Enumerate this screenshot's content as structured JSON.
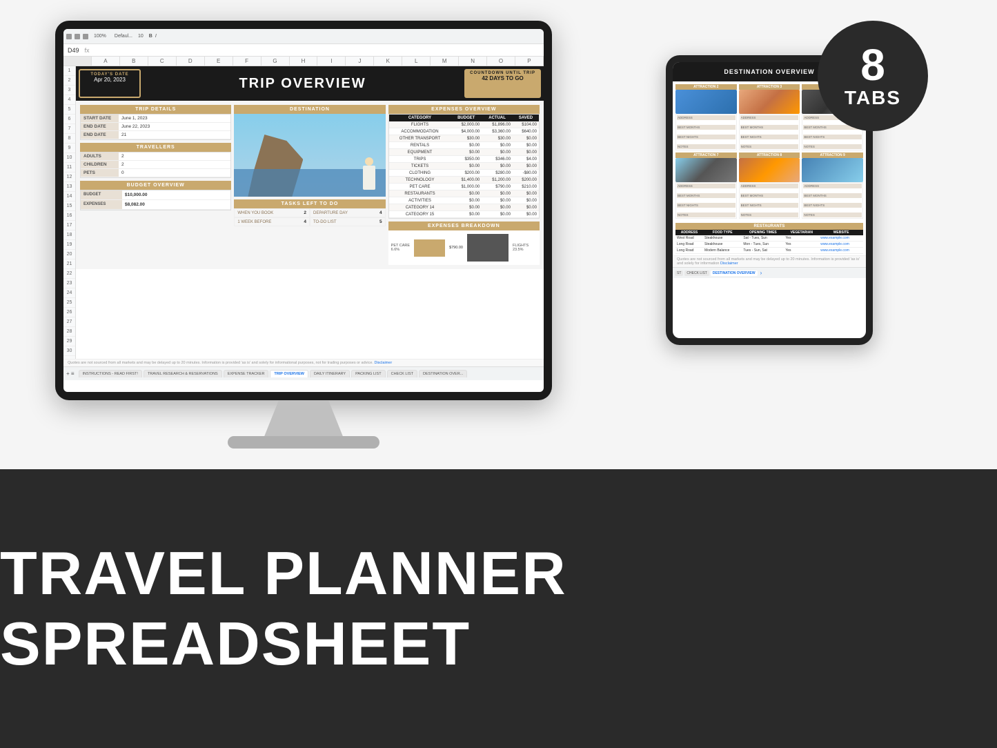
{
  "top_section": {
    "badge": {
      "number": "8",
      "word": "TABS"
    }
  },
  "spreadsheet": {
    "toolbar": {
      "zoom": "100%",
      "font": "Defaul...",
      "size": "10",
      "cell_ref": "D49"
    },
    "header": {
      "today_label": "TODAY'S DATE",
      "today_date": "Apr 20, 2023",
      "title": "TRIP OVERVIEW",
      "countdown_label": "COUNTDOWN UNTIL TRIP",
      "countdown_value": "42 DAYS TO GO"
    },
    "trip_details": {
      "header": "TRIP DETAILS",
      "rows": [
        {
          "label": "START DATE",
          "value": "June 1, 2023"
        },
        {
          "label": "END DATE",
          "value": "June 22, 2023"
        },
        {
          "label": "END DATE",
          "value": "21"
        }
      ]
    },
    "travellers": {
      "header": "TRAVELLERS",
      "rows": [
        {
          "label": "ADULTS",
          "value": "2"
        },
        {
          "label": "CHILDREN",
          "value": "2"
        },
        {
          "label": "PETS",
          "value": "0"
        }
      ]
    },
    "budget": {
      "header": "BUDGET OVERVIEW",
      "rows": [
        {
          "label": "BUDGET",
          "value": "$10,000.00"
        },
        {
          "label": "EXPENSES",
          "value": "$8,082.00"
        }
      ]
    },
    "destination": {
      "header": "DESTINATION"
    },
    "tasks": {
      "header": "TASKS LEFT TO DO",
      "cells": [
        {
          "label": "WHEN YOU BOOK",
          "value": "2"
        },
        {
          "label": "DEPARTURE DAY",
          "value": "4"
        },
        {
          "label": "1 WEEK BEFORE",
          "value": "4"
        },
        {
          "label": "TO-DO LIST",
          "value": "5"
        }
      ]
    },
    "expenses_overview": {
      "header": "EXPENSES OVERVIEW",
      "columns": [
        "CATEGORY",
        "BUDGET",
        "ACTUAL",
        "SAVED"
      ],
      "rows": [
        {
          "category": "FLIGHTS",
          "budget": "$2,000.00",
          "actual": "$1,896.00",
          "saved": "$104.00"
        },
        {
          "category": "ACCOMMODATION",
          "budget": "$4,000.00",
          "actual": "$3,360.00",
          "saved": "$640.00"
        },
        {
          "category": "OTHER TRANSPORT",
          "budget": "$30.00",
          "actual": "$30.00",
          "saved": "$0.00"
        },
        {
          "category": "RENTALS",
          "budget": "$0.00",
          "actual": "$0.00",
          "saved": "$0.00"
        },
        {
          "category": "EQUIPMENT",
          "budget": "$0.00",
          "actual": "$0.00",
          "saved": "$0.00"
        },
        {
          "category": "TRIPS",
          "budget": "$350.00",
          "actual": "$346.00",
          "saved": "$4.00"
        },
        {
          "category": "TICKETS",
          "budget": "$0.00",
          "actual": "$0.00",
          "saved": "$0.00"
        },
        {
          "category": "CLOTHING",
          "budget": "$200.00",
          "actual": "$280.00",
          "saved": "-$80.00"
        },
        {
          "category": "TECHNOLOGY",
          "budget": "$1,400.00",
          "actual": "$1,200.00",
          "saved": "$200.00"
        },
        {
          "category": "PET CARE",
          "budget": "$1,000.00",
          "actual": "$790.00",
          "saved": "$210.00"
        },
        {
          "category": "RESTAURANTS",
          "budget": "$0.00",
          "actual": "$0.00",
          "saved": "$0.00"
        },
        {
          "category": "ACTIVITIES",
          "budget": "$0.00",
          "actual": "$0.00",
          "saved": "$0.00"
        },
        {
          "category": "CATEGORY 14",
          "budget": "$0.00",
          "actual": "$0.00",
          "saved": "$0.00"
        },
        {
          "category": "CATEGORY 15",
          "budget": "$0.00",
          "actual": "$0.00",
          "saved": "$0.00"
        }
      ]
    },
    "expenses_breakdown": {
      "header": "EXPENSES BREAKDOWN",
      "bars": [
        {
          "label": "PET CARE\n6.6%",
          "value": "$790.00",
          "height": 30
        },
        {
          "label": "FLIGHTS\n23.5%",
          "value": "",
          "height": 45
        }
      ]
    },
    "disclaimer": "Quotes are not sourced from all markets and may be delayed up to 20 minutes. Information is provided 'as is' and solely for informational purposes, not for trading purposes or advice.",
    "disclaimer_link": "Disclaimer",
    "tabs": [
      {
        "label": "INSTRUCTIONS - READ FIRST!",
        "active": false
      },
      {
        "label": "TRAVEL RESEARCH & RESERVATIONS",
        "active": false
      },
      {
        "label": "EXPENSE TRACKER",
        "active": false
      },
      {
        "label": "TRIP OVERVIEW",
        "active": true
      },
      {
        "label": "DAILY ITINERARY",
        "active": false
      },
      {
        "label": "PACKING LIST",
        "active": false
      },
      {
        "label": "CHECK LIST",
        "active": false
      },
      {
        "label": "DESTINATION OVER...",
        "active": false
      }
    ]
  },
  "tablet": {
    "title": "DESTINATION OVERVIEW",
    "attractions": [
      {
        "label": "ATTRACTION 2",
        "img_class": "attraction-img-1"
      },
      {
        "label": "ATTRACTION 3",
        "img_class": "attraction-img-2"
      },
      {
        "label": "ATTRACTION 4",
        "img_class": "attraction-img-3"
      },
      {
        "label": "ATTRACTION 7",
        "img_class": "attraction-img-4"
      },
      {
        "label": "ATTRACTION 8",
        "img_class": "attraction-img-5"
      },
      {
        "label": "ATTRACTION 9",
        "img_class": "attraction-img-6"
      }
    ],
    "restaurants": {
      "header": "RESTAURANTS",
      "columns": [
        "ADDRESS",
        "FOOD TYPE",
        "OPENING TIMES",
        "VEGETARIAN",
        "WEBSITE"
      ],
      "rows": [
        {
          "address": "West Road",
          "food_type": "Steakhouse",
          "hours": "Sat - Tues, Sun",
          "veg": "Yes",
          "website": "www.example.com"
        },
        {
          "address": "Long Road",
          "food_type": "Steakhouse",
          "hours": "Mon - Tues, Sun",
          "veg": "Yes",
          "website": "www.example.com"
        },
        {
          "address": "Long Road",
          "food_type": "Modern Balance",
          "hours": "Tues - Sun, Sat",
          "veg": "Yes",
          "website": "www.example.com"
        }
      ]
    },
    "disclaimer": "Quotes are not sourced from all markets and may be delayed up to 20 minutes. Information is provided 'as is' and solely for information",
    "disclaimer_link": "Disclaimer",
    "tabs": [
      {
        "label": "ST",
        "active": false
      },
      {
        "label": "CHECK LIST",
        "active": false
      },
      {
        "label": "DESTINATION OVERVIEW",
        "active": true
      }
    ]
  },
  "bottom": {
    "title": "TRAVEL PLANNER SPREADSHEET"
  }
}
